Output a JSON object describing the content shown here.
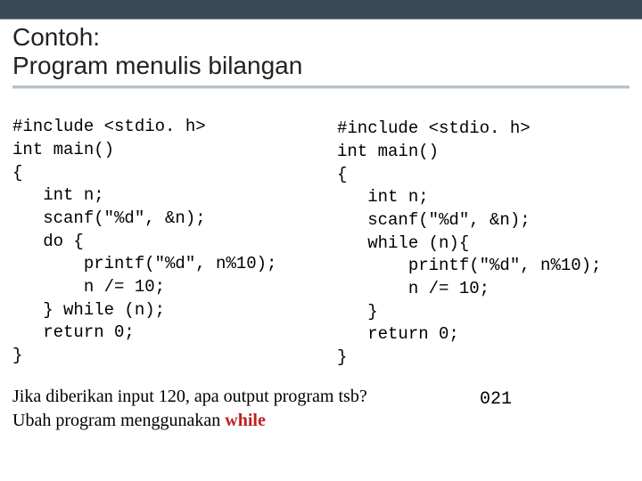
{
  "title": {
    "line1": "Contoh:",
    "line2": "Program menulis bilangan"
  },
  "code_left": "#include <stdio. h>\nint main()\n{\n   int n;\n   scanf(\"%d\", &n);\n   do {\n       printf(\"%d\", n%10);\n       n /= 10;\n   } while (n);\n   return 0;\n}",
  "code_right": "#include <stdio. h>\nint main()\n{\n   int n;\n   scanf(\"%d\", &n);\n   while (n){\n       printf(\"%d\", n%10);\n       n /= 10;\n   }\n   return 0;\n}",
  "question": {
    "line1": "Jika diberikan input 120, apa output program tsb?",
    "line2_prefix": "Ubah program menggunakan  ",
    "line2_keyword": "while"
  },
  "answer": "021"
}
